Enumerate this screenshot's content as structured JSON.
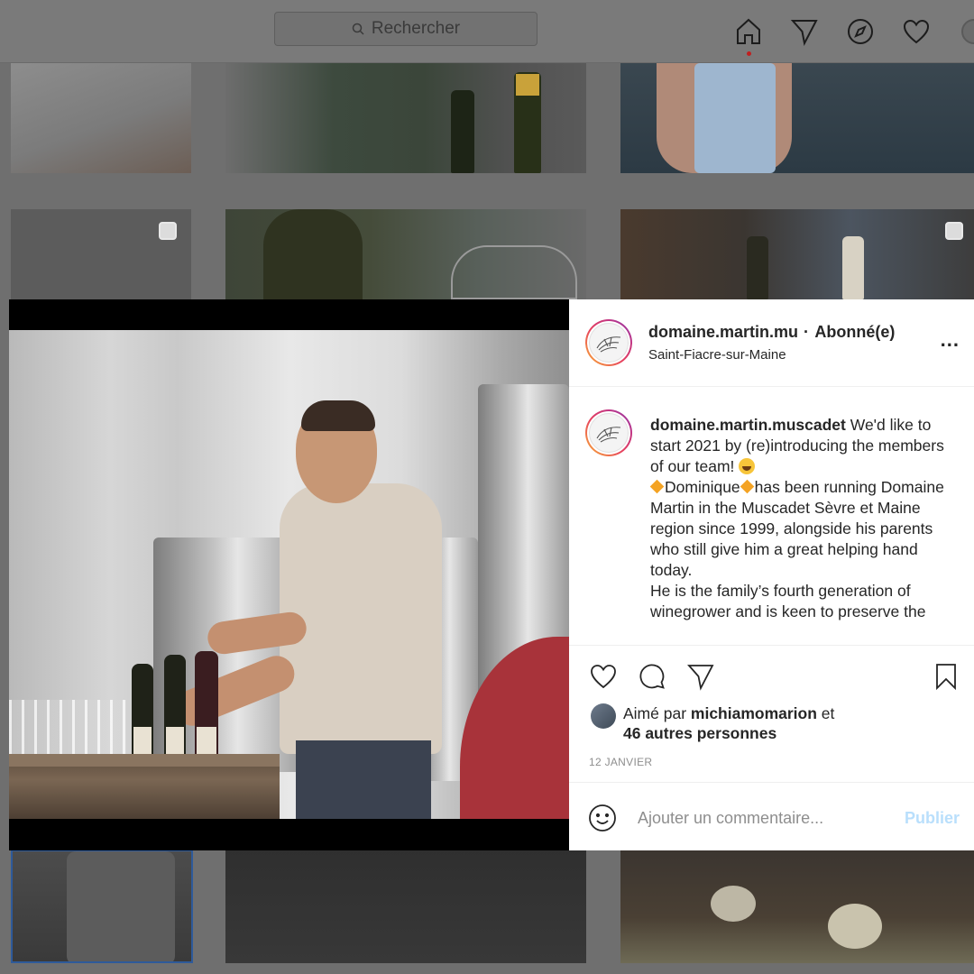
{
  "topbar": {
    "search_placeholder": "Rechercher",
    "icons": [
      "home-icon",
      "direct-icon",
      "explore-icon",
      "activity-icon",
      "profile-avatar"
    ]
  },
  "post": {
    "header": {
      "username": "domaine.martin.mu",
      "separator": "·",
      "follow_status": "Abonné(e)",
      "location": "Saint-Fiacre-sur-Maine",
      "more_label": "..."
    },
    "caption": {
      "username": "domaine.martin.muscadet",
      "text_1": " We'd like to start 2021 by (re)introducing the members of our team! ",
      "name": "Dominique",
      "text_2": "has been running Domaine Martin in the Muscadet Sèvre et Maine region since 1999, alongside his parents who still give him a great helping hand today.",
      "text_3": "He is the family’s fourth generation of winegrower and is keen to preserve the"
    },
    "likes": {
      "prefix": "Aimé par ",
      "liker": "michiamomarion",
      "suffix": " et",
      "others": "46 autres personnes"
    },
    "date": "12 JANVIER",
    "comment": {
      "placeholder": "Ajouter un commentaire...",
      "publish_label": "Publier"
    }
  },
  "colors": {
    "accent_blue_disabled": "#b9dffc",
    "notification_dot": "#c02020",
    "story_ring": [
      "#f9b233",
      "#e6405f",
      "#c13584",
      "#833ab4"
    ]
  }
}
